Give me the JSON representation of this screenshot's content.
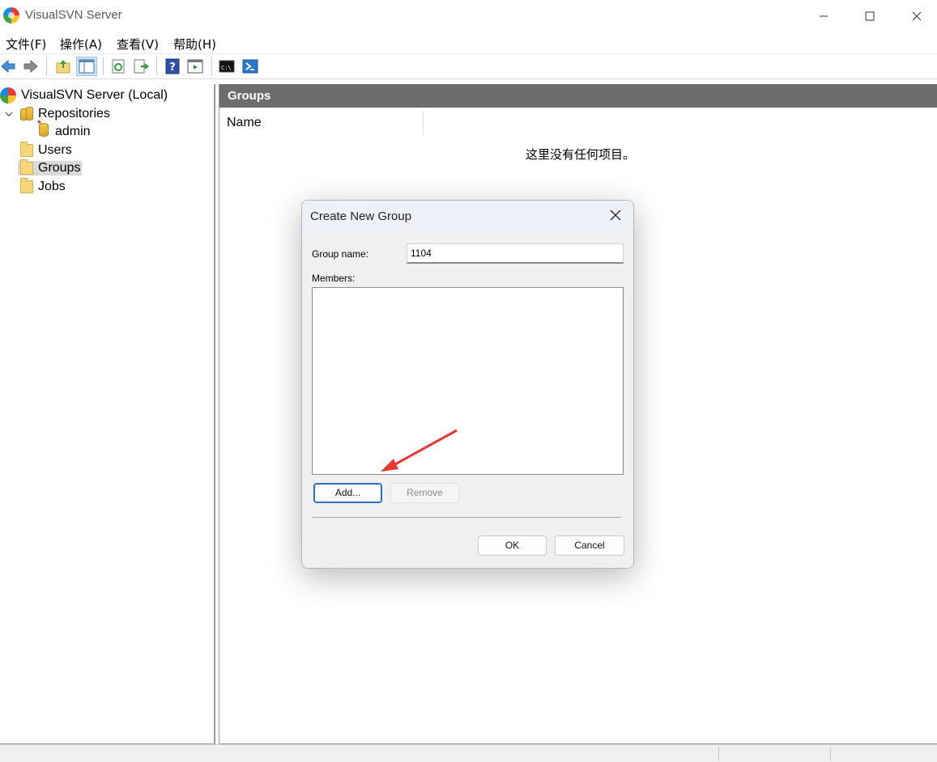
{
  "window": {
    "title": "VisualSVN Server"
  },
  "menu": {
    "items": [
      "文件(F)",
      "操作(A)",
      "查看(V)",
      "帮助(H)"
    ]
  },
  "toolbar": {
    "icons": [
      "back-arrow-icon",
      "forward-arrow-icon",
      "up-folder-icon",
      "show-hide-tree-icon",
      "refresh-icon",
      "export-list-icon",
      "help-icon",
      "properties-icon",
      "console-icon",
      "powershell-icon"
    ]
  },
  "tree": {
    "root": "VisualSVN Server (Local)",
    "repositories": "Repositories",
    "repo_child": "admin",
    "users": "Users",
    "groups": "Groups",
    "jobs": "Jobs"
  },
  "main": {
    "header": "Groups",
    "column_name": "Name",
    "empty_message": "这里没有任何项目。"
  },
  "dialog": {
    "title": "Create New Group",
    "group_name_label": "Group name:",
    "group_name_value": "1104",
    "members_label": "Members:",
    "add_label": "Add...",
    "remove_label": "Remove",
    "ok_label": "OK",
    "cancel_label": "Cancel"
  },
  "colors": {
    "accent": "#2b6fc7",
    "pane_header": "#6d6d6d",
    "annotation_arrow": "#e53935"
  }
}
